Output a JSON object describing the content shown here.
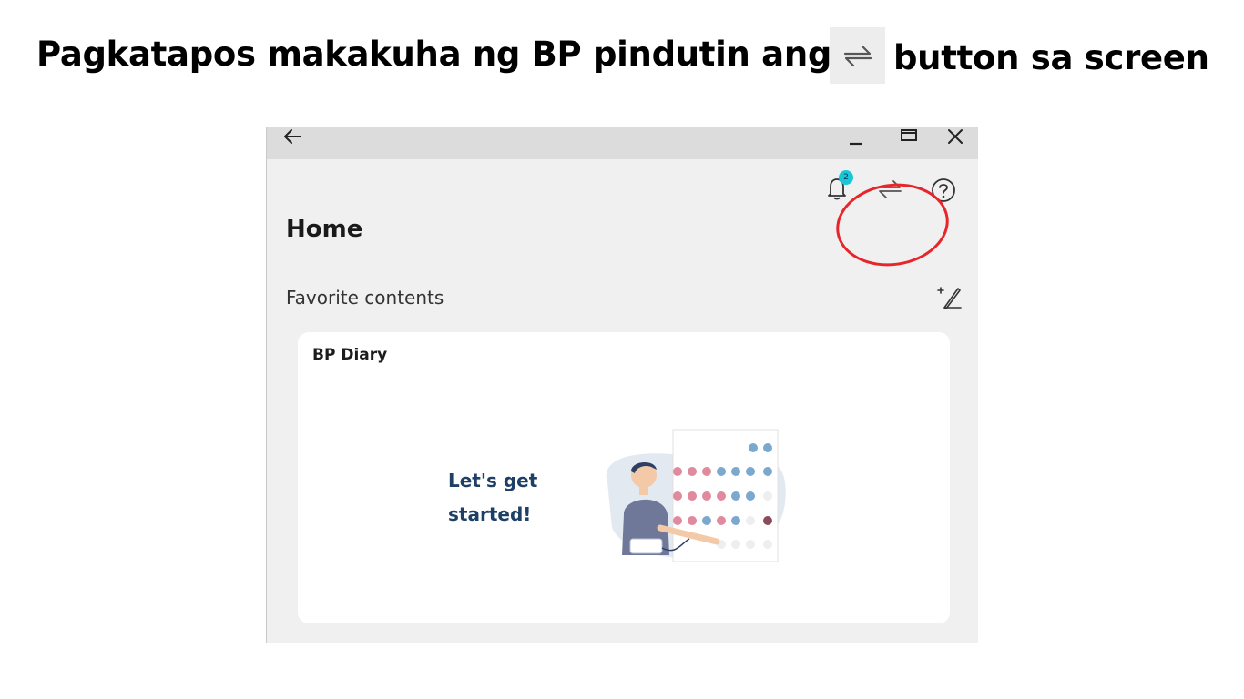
{
  "instruction": {
    "text_before_icon": "Pagkatapos makakuha ng BP pindutin ang",
    "icon": "sync-arrows-icon",
    "text_after_icon": "button sa screen"
  },
  "window": {
    "titlebar": {
      "back_icon": "arrow-left-icon",
      "minimize_icon": "minimize-icon",
      "maximize_icon": "maximize-icon",
      "close_icon": "close-icon"
    },
    "header_icons": {
      "notifications_icon": "bell-icon",
      "notification_count": "2",
      "sync_icon": "sync-arrows-icon",
      "help_icon": "help-circle-icon"
    },
    "highlight_color": "#e8252a",
    "page_title": "Home",
    "favorites": {
      "label": "Favorite contents",
      "edit_icon": "edit-favorites-icon"
    },
    "card": {
      "title": "BP Diary",
      "message_line1": "Let's get",
      "message_line2": "started!",
      "illustration": "bp-diary-illustration"
    }
  },
  "colors": {
    "accent_badge": "#17c7d8",
    "message_text": "#1e3f66",
    "window_bg": "#f0f0f0",
    "titlebar_bg": "#dcdcdc"
  }
}
